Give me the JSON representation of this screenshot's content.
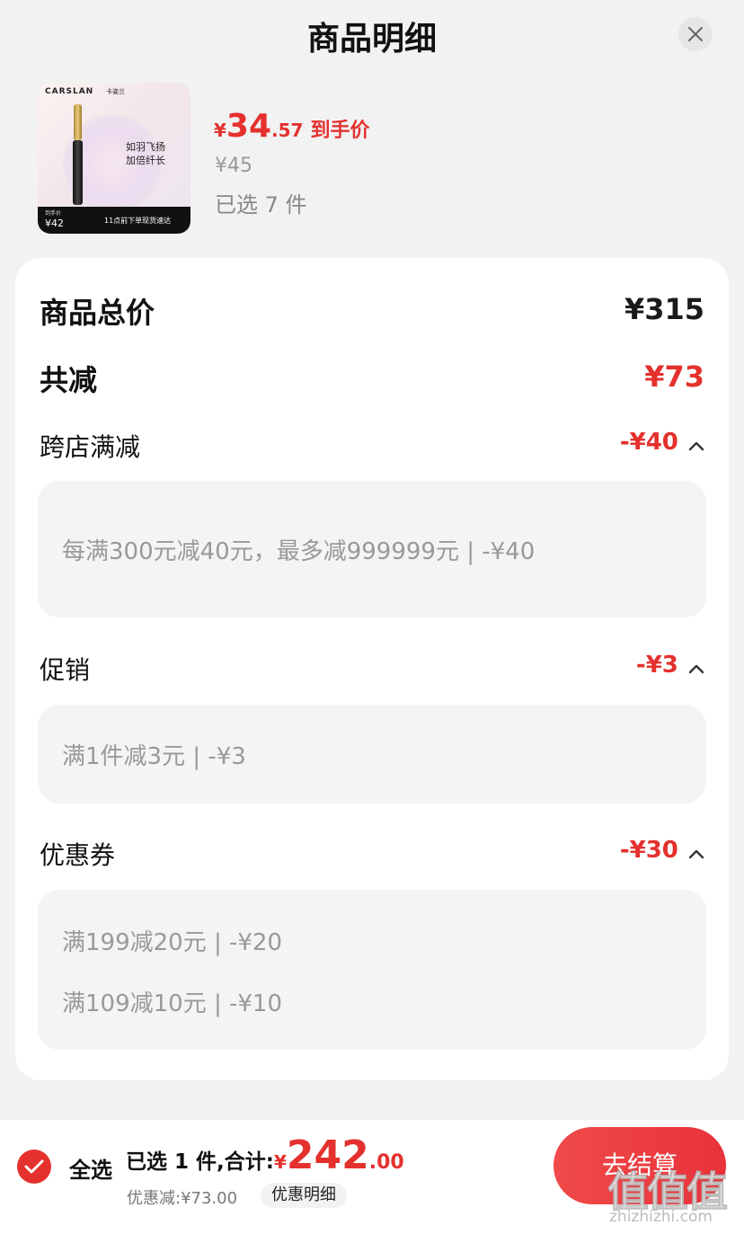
{
  "header": {
    "title": "商品明细"
  },
  "product": {
    "image": {
      "brand": "CARSLAN",
      "brand_cn": "卡姿兰",
      "slogan_line1": "如羽飞扬",
      "slogan_line2": "加倍纤长",
      "price_label": "到手价",
      "price": "¥42",
      "shipping": "11点前下单现货速达"
    },
    "deal_price_symbol": "¥",
    "deal_price_int": "34",
    "deal_price_dec": ".57",
    "deal_price_label": "到手价",
    "original_price": "¥45",
    "selected_count": "已选 7 件"
  },
  "breakdown": {
    "total_label": "商品总价",
    "total_value": "¥315",
    "reduce_label": "共减",
    "reduce_value": "¥73",
    "sections": [
      {
        "label": "跨店满减",
        "value": "-¥40",
        "items": [
          "每满300元减40元，最多减999999元 | -¥40"
        ]
      },
      {
        "label": "促销",
        "value": "-¥3",
        "items": [
          "满1件减3元 | -¥3"
        ]
      },
      {
        "label": "优惠券",
        "value": "-¥30",
        "items": [
          "满199减20元 | -¥20",
          "满109减10元 | -¥10"
        ]
      }
    ]
  },
  "footer": {
    "select_all": "全选",
    "summary_text": "已选 1 件,合计:",
    "total_symbol": "¥",
    "total_int": "242",
    "total_dec": ".00",
    "discount_note": "优惠减:¥73.00",
    "detail_link": "优惠明细",
    "checkout": "去结算"
  },
  "watermark": {
    "logo": "值值值",
    "url": "zhizhizhi.com"
  },
  "colors": {
    "accent": "#e4312e",
    "background": "#f2f2f2",
    "card": "#ffffff",
    "box": "#f4f4f4"
  },
  "icons": [
    "close-icon",
    "chevron-up-icon",
    "check-icon"
  ]
}
